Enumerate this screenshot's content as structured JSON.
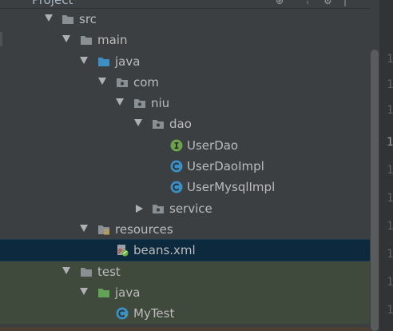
{
  "window": {
    "title": "Project"
  },
  "colors": {
    "background": "#3c3f41",
    "selection": "#0d293e",
    "test_tint": "#3f4a3c",
    "folder_gray": "#8a8f93",
    "folder_source": "#3d8fc1",
    "folder_test": "#62a357",
    "interface_icon": "#6ca34a",
    "class_icon": "#3b8ec2",
    "text": "#bbbbbb"
  },
  "tree": {
    "items": [
      {
        "label": "src",
        "icon": "folder-icon",
        "expanded": true
      },
      {
        "label": "main",
        "icon": "folder-icon",
        "expanded": true
      },
      {
        "label": "java",
        "icon": "source-root-folder-icon",
        "expanded": true
      },
      {
        "label": "com",
        "icon": "package-icon",
        "expanded": true
      },
      {
        "label": "niu",
        "icon": "package-icon",
        "expanded": true
      },
      {
        "label": "dao",
        "icon": "package-icon",
        "expanded": true
      },
      {
        "label": "UserDao",
        "icon": "interface-icon"
      },
      {
        "label": "UserDaoImpl",
        "icon": "class-icon"
      },
      {
        "label": "UserMysqlImpl",
        "icon": "class-icon"
      },
      {
        "label": "service",
        "icon": "package-icon",
        "expanded": false
      },
      {
        "label": "resources",
        "icon": "resources-folder-icon",
        "expanded": true
      },
      {
        "label": "beans.xml",
        "icon": "spring-xml-icon",
        "selected": true
      },
      {
        "label": "test",
        "icon": "folder-icon",
        "expanded": true
      },
      {
        "label": "java",
        "icon": "test-source-folder-icon",
        "expanded": true
      },
      {
        "label": "MyTest",
        "icon": "test-class-icon"
      }
    ]
  },
  "gutter": {
    "line_marker": "1"
  }
}
